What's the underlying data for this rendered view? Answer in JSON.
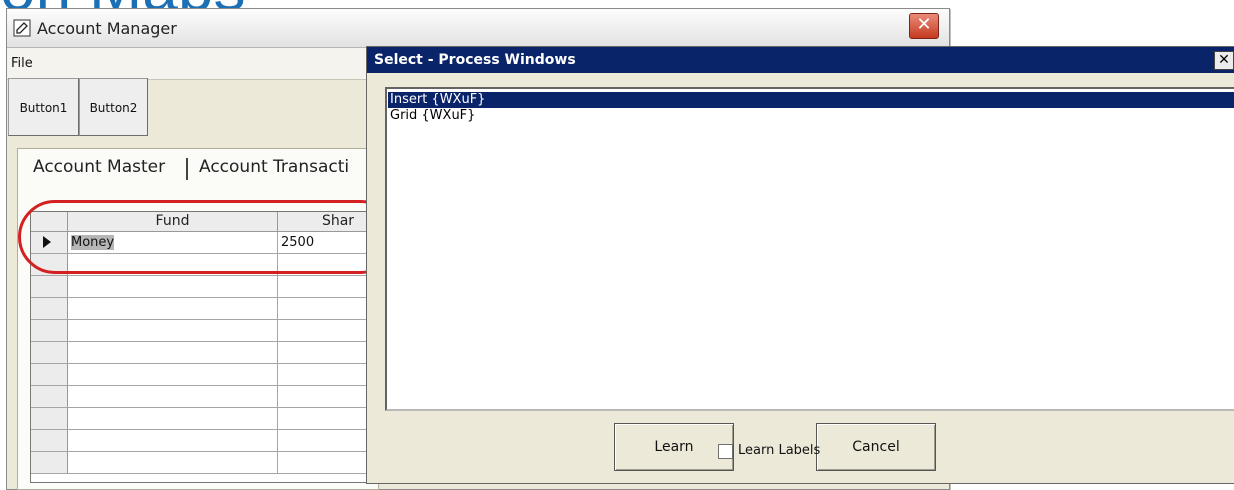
{
  "slide": {
    "title_fragment": "on Maps"
  },
  "account_manager": {
    "title": "Account Manager",
    "menu": {
      "file": "File"
    },
    "toolbar": {
      "button1": "Button1",
      "button2": "Button2"
    },
    "tabs": [
      {
        "label": "Account Master"
      },
      {
        "label": "Account Transacti"
      }
    ],
    "grid": {
      "columns": [
        "Fund",
        "Shar"
      ],
      "rows": [
        [
          "Money",
          "2500"
        ],
        [
          "",
          ""
        ],
        [
          "",
          ""
        ],
        [
          "",
          ""
        ],
        [
          "",
          ""
        ],
        [
          "",
          ""
        ],
        [
          "",
          ""
        ],
        [
          "",
          ""
        ],
        [
          "",
          ""
        ],
        [
          "",
          ""
        ],
        [
          "",
          ""
        ]
      ]
    },
    "close_glyph": "✕"
  },
  "dialog": {
    "title": "Select - Process Windows",
    "close_glyph": "✕",
    "items": [
      {
        "label": "Insert {WXuF}",
        "selected": true
      },
      {
        "label": "Grid {WXuF}",
        "selected": false
      }
    ],
    "learn_button": "Learn",
    "cancel_button": "Cancel",
    "learn_labels": "Learn Labels"
  },
  "colors": {
    "titlebar_active": "#0a246a",
    "window_bg": "#ece9d8",
    "annotation_red": "#d42020",
    "slide_title_blue": "#1b6fb5"
  },
  "icons": {
    "window_icon": "pencil-icon",
    "row_indicator": "row-arrow-icon"
  }
}
